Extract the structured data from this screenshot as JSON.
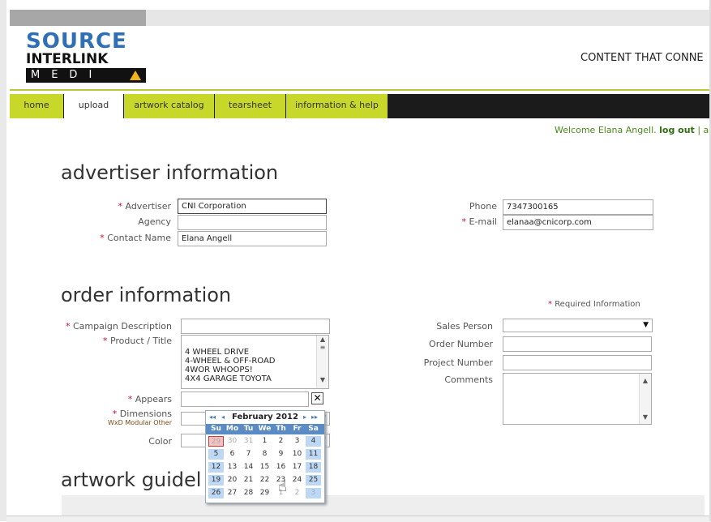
{
  "brand": {
    "line1": "SOURCE",
    "line2": "INTERLINK",
    "line3": "MEDI",
    "tagline": "CONTENT THAT CONNE"
  },
  "nav": {
    "tabs": [
      {
        "label": "home"
      },
      {
        "label": "upload"
      },
      {
        "label": "artwork catalog"
      },
      {
        "label": "tearsheet"
      },
      {
        "label": "information & help"
      }
    ]
  },
  "user": {
    "welcome": "Welcome Elana Angell.",
    "logout": "log out",
    "sep": "|",
    "account": "acc"
  },
  "advertiser": {
    "heading": "advertiser information",
    "advertiser_label": "Advertiser",
    "advertiser_value": "CNI Corporation",
    "agency_label": "Agency",
    "agency_value": "",
    "contact_label": "Contact Name",
    "contact_value": "Elana Angell",
    "phone_label": "Phone",
    "phone_value": "7347300165",
    "email_label": "E-mail",
    "email_value": "elanaa@cnicorp.com"
  },
  "order": {
    "heading": "order information",
    "required_note": "Required Information",
    "campaign_label": "Campaign Description",
    "campaign_value": "",
    "product_label": "Product / Title",
    "products": [
      "4 WHEEL DRIVE",
      "4-WHEEL & OFF-ROAD",
      "4WOR WHOOPS!",
      "4X4 GARAGE TOYOTA"
    ],
    "appears_label": "Appears",
    "appears_value": "",
    "dimensions_label": "Dimensions",
    "dimensions_sub": "WxD Modular Other",
    "color_label": "Color",
    "sales_label": "Sales Person",
    "sales_value": "",
    "order_number_label": "Order Number",
    "order_number_value": "",
    "project_number_label": "Project Number",
    "project_number_value": "",
    "comments_label": "Comments",
    "comments_value": "",
    "clear_glyph": "✕"
  },
  "artwork": {
    "heading": "artwork guidel"
  },
  "calendar": {
    "month": "February 2012",
    "prev_year": "◂◂",
    "prev_month": "◂",
    "next_month": "▸",
    "next_year": "▸▸",
    "dows": [
      "Su",
      "Mo",
      "Tu",
      "We",
      "Th",
      "Fr",
      "Sa"
    ],
    "weeks": [
      [
        "29",
        "30",
        "31",
        "1",
        "2",
        "3",
        "4"
      ],
      [
        "5",
        "6",
        "7",
        "8",
        "9",
        "10",
        "11"
      ],
      [
        "12",
        "13",
        "14",
        "15",
        "16",
        "17",
        "18"
      ],
      [
        "19",
        "20",
        "21",
        "22",
        "23",
        "24",
        "25"
      ],
      [
        "26",
        "27",
        "28",
        "29",
        "1",
        "2",
        "3"
      ]
    ]
  },
  "colors": {
    "nav_tab": "#c8d82a",
    "nav_bar": "#1b1b1b",
    "required_star": "#c8102e",
    "welcome_text": "#4a8a1e",
    "calendar_header": "#5b8bc4",
    "calendar_weekend": "#bcd8f5"
  }
}
